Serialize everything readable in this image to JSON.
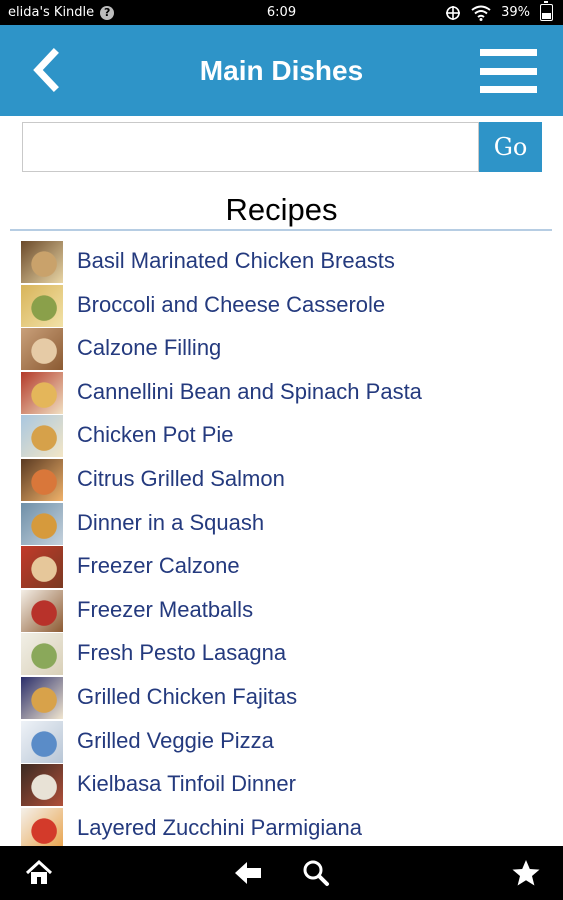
{
  "status_bar": {
    "device_name": "elida's Kindle",
    "help_glyph": "?",
    "time": "6:09",
    "battery": "39%",
    "battery_level": 0.39,
    "icons": [
      "sync-icon",
      "wifi-icon",
      "battery-icon"
    ]
  },
  "header": {
    "title": "Main Dishes",
    "back_icon": "chevron-left-icon",
    "menu_icon": "hamburger-menu-icon",
    "background_color": "#2e94c8"
  },
  "search": {
    "value": "",
    "placeholder": "",
    "go_label": "Go"
  },
  "section": {
    "heading": "Recipes"
  },
  "recipes": [
    {
      "label": "Basil Marinated Chicken Breasts",
      "thumb_colors": [
        "#6b4a2a",
        "#c9a26b",
        "#e9d6a6"
      ]
    },
    {
      "label": "Broccoli and Cheese Casserole",
      "thumb_colors": [
        "#d8b45a",
        "#8aa04a",
        "#f2e2a8"
      ]
    },
    {
      "label": "Calzone Filling",
      "thumb_colors": [
        "#c9a07a",
        "#e6cba6",
        "#8b5a32"
      ]
    },
    {
      "label": "Cannellini Bean and Spinach Pasta",
      "thumb_colors": [
        "#b33a2a",
        "#e4b65a",
        "#f1e0c2"
      ]
    },
    {
      "label": "Chicken Pot Pie",
      "thumb_colors": [
        "#a9c7e0",
        "#d6a14a",
        "#f3e6c6"
      ]
    },
    {
      "label": "Citrus Grilled Salmon",
      "thumb_colors": [
        "#5a3a22",
        "#d9773a",
        "#f0b26a"
      ]
    },
    {
      "label": "Dinner in a Squash",
      "thumb_colors": [
        "#6e8fa8",
        "#d69a3c",
        "#c5d2dd"
      ]
    },
    {
      "label": "Freezer Calzone",
      "thumb_colors": [
        "#c23a2a",
        "#e6c79a",
        "#7a3a22"
      ]
    },
    {
      "label": "Freezer Meatballs",
      "thumb_colors": [
        "#f3eee6",
        "#b8322a",
        "#8c5a32"
      ]
    },
    {
      "label": "Fresh Pesto Lasagna",
      "thumb_colors": [
        "#f1efe6",
        "#8aa85a",
        "#d9d0b8"
      ]
    },
    {
      "label": "Grilled Chicken Fajitas",
      "thumb_colors": [
        "#2a2e6a",
        "#d8a24a",
        "#f1e6d0"
      ]
    },
    {
      "label": "Grilled Veggie Pizza",
      "thumb_colors": [
        "#eef2f7",
        "#5a8cc8",
        "#b8c6d6"
      ]
    },
    {
      "label": "Kielbasa Tinfoil Dinner",
      "thumb_colors": [
        "#3a2a22",
        "#e8e2d6",
        "#b0503a"
      ]
    },
    {
      "label": "Layered Zucchini Parmigiana",
      "thumb_colors": [
        "#f4f0ea",
        "#d33a2a",
        "#e8a24a"
      ]
    }
  ],
  "bottom_nav": {
    "icons": [
      "home-icon",
      "back-arrow-icon",
      "search-icon",
      "star-icon"
    ]
  }
}
